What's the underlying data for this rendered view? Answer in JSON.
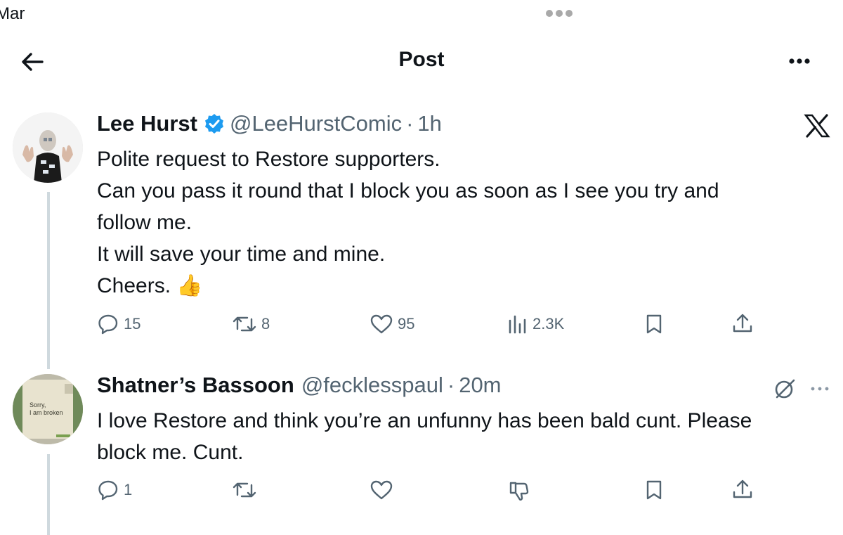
{
  "status_bar": {
    "time_fragment": "Mar"
  },
  "header": {
    "title": "Post"
  },
  "post": {
    "author_name": "Lee Hurst",
    "handle": "@LeeHurstComic",
    "separator": "·",
    "time": "1h",
    "lines": [
      "Polite request to Restore supporters.",
      "Can you pass it round that I block you as soon as I see you try and",
      "follow me.",
      "It will save your time and mine.",
      "Cheers."
    ],
    "emoji": "👍",
    "replies": "15",
    "reposts": "8",
    "likes": "95",
    "views": "2.3K",
    "verified_color": "#1d9bf0"
  },
  "reply": {
    "author_name": "Shatner’s Bassoon",
    "handle": "@fecklesspaul",
    "separator": "·",
    "time": "20m",
    "lines": [
      "I love Restore and think you’re an unfunny has been bald cunt. Please",
      "block me. Cunt."
    ],
    "avatar_text": [
      "Sorry,",
      "I am broken"
    ],
    "replies": "1"
  },
  "icons": {
    "back": "arrow-left-icon",
    "more": "more-horizontal-icon",
    "x_logo": "x-logo-icon",
    "reply": "reply-icon",
    "repost": "repost-icon",
    "like": "heart-icon",
    "views": "analytics-icon",
    "bookmark": "bookmark-icon",
    "share": "share-icon",
    "dislike": "thumbs-down-icon",
    "grok": "grok-icon"
  }
}
